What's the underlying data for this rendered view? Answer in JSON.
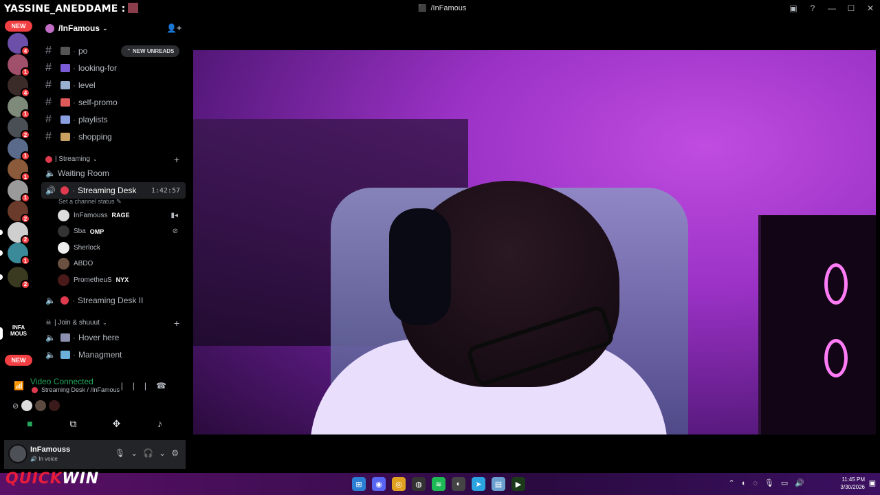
{
  "overlay": {
    "username": "YASSINE_ANEDDAME :"
  },
  "window": {
    "title": "/InFamous",
    "buttons": {
      "inbox": "▣",
      "help": "?",
      "minimize": "—",
      "maximize": "☐",
      "close": "✕"
    }
  },
  "rail": {
    "new_top": "NEW",
    "new_bottom": "NEW",
    "servers": [
      {
        "badge": "4",
        "color": "#6b4fa8"
      },
      {
        "badge": "1",
        "color": "#a0506a"
      },
      {
        "badge": "4",
        "color": "#3a2a28"
      },
      {
        "badge": "1",
        "color": "#7e8a7a"
      },
      {
        "badge": "2",
        "color": "#4a4f55"
      },
      {
        "badge": "1",
        "color": "#5a6a8a"
      },
      {
        "badge": "1",
        "color": "#8a5a3a"
      },
      {
        "badge": "1",
        "color": "#9a9a9a"
      },
      {
        "badge": "2",
        "color": "#6a3a2a"
      },
      {
        "badge": "2",
        "color": "#cfcfcf"
      },
      {
        "badge": "1",
        "color": "#3a8a9a"
      },
      {
        "badge": "2",
        "color": "#3a3a20"
      }
    ],
    "infamous_text": "INFA MOUS"
  },
  "guild": {
    "name": "/InFamous",
    "new_unreads": "NEW UNREADS",
    "text_channels": [
      {
        "name": "po",
        "emoji_color": "#555"
      },
      {
        "name": "looking-for",
        "emoji_color": "#7c5cd6"
      },
      {
        "name": "level",
        "emoji_color": "#9ab0d0"
      },
      {
        "name": "self-promo",
        "emoji_color": "#e05a5a"
      },
      {
        "name": "playlists",
        "emoji_color": "#8aa0e0"
      },
      {
        "name": "shopping",
        "emoji_color": "#c8a060"
      }
    ],
    "category_streaming": "| Streaming",
    "waiting_room": "Waiting Room",
    "streaming_desk": "Streaming Desk",
    "streaming_timer": "1:42:57",
    "set_status": "Set a channel status",
    "voice_users": [
      {
        "name": "InFamouss",
        "tag": "RAGE",
        "right": "▮◂"
      },
      {
        "name": "Sba",
        "tag": "OMP",
        "right": "⊘"
      },
      {
        "name": "Sherlock",
        "tag": "",
        "right": ""
      },
      {
        "name": "ABDO",
        "tag": "",
        "right": ""
      },
      {
        "name": "PrometheuS",
        "tag": "NYX",
        "right": ""
      }
    ],
    "streaming_desk_2": "Streaming Desk II",
    "category_join": "| Join & shuuut",
    "hover_here": "Hover here",
    "managment": "Managment"
  },
  "voice_panel": {
    "title": "Video Connected",
    "subtitle": "Streaming Desk / /InFamous"
  },
  "user_panel": {
    "name": "InFamouss",
    "status": "In voice"
  },
  "taskbar": {
    "brand_q": "QUICK",
    "brand_w": "WIN",
    "time": "11:45 PM",
    "date": "3/30/2026"
  }
}
